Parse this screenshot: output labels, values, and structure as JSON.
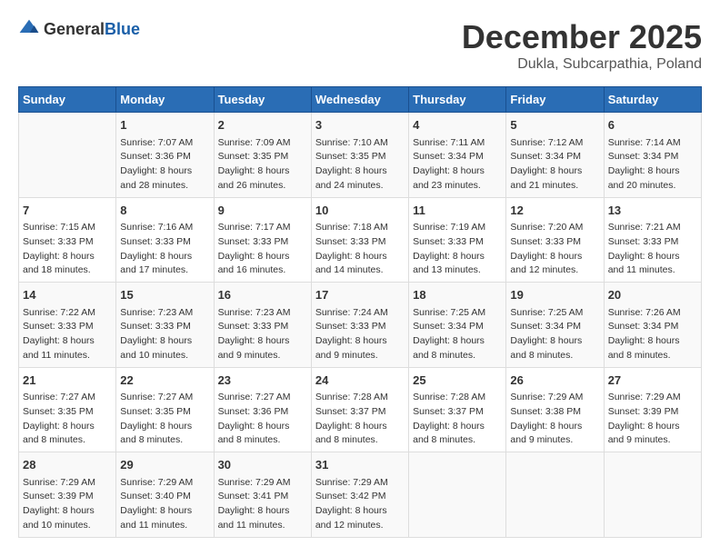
{
  "header": {
    "logo_general": "General",
    "logo_blue": "Blue",
    "title": "December 2025",
    "subtitle": "Dukla, Subcarpathia, Poland"
  },
  "days_of_week": [
    "Sunday",
    "Monday",
    "Tuesday",
    "Wednesday",
    "Thursday",
    "Friday",
    "Saturday"
  ],
  "weeks": [
    [
      {
        "day": "",
        "info": ""
      },
      {
        "day": "1",
        "info": "Sunrise: 7:07 AM\nSunset: 3:36 PM\nDaylight: 8 hours\nand 28 minutes."
      },
      {
        "day": "2",
        "info": "Sunrise: 7:09 AM\nSunset: 3:35 PM\nDaylight: 8 hours\nand 26 minutes."
      },
      {
        "day": "3",
        "info": "Sunrise: 7:10 AM\nSunset: 3:35 PM\nDaylight: 8 hours\nand 24 minutes."
      },
      {
        "day": "4",
        "info": "Sunrise: 7:11 AM\nSunset: 3:34 PM\nDaylight: 8 hours\nand 23 minutes."
      },
      {
        "day": "5",
        "info": "Sunrise: 7:12 AM\nSunset: 3:34 PM\nDaylight: 8 hours\nand 21 minutes."
      },
      {
        "day": "6",
        "info": "Sunrise: 7:14 AM\nSunset: 3:34 PM\nDaylight: 8 hours\nand 20 minutes."
      }
    ],
    [
      {
        "day": "7",
        "info": "Sunrise: 7:15 AM\nSunset: 3:33 PM\nDaylight: 8 hours\nand 18 minutes."
      },
      {
        "day": "8",
        "info": "Sunrise: 7:16 AM\nSunset: 3:33 PM\nDaylight: 8 hours\nand 17 minutes."
      },
      {
        "day": "9",
        "info": "Sunrise: 7:17 AM\nSunset: 3:33 PM\nDaylight: 8 hours\nand 16 minutes."
      },
      {
        "day": "10",
        "info": "Sunrise: 7:18 AM\nSunset: 3:33 PM\nDaylight: 8 hours\nand 14 minutes."
      },
      {
        "day": "11",
        "info": "Sunrise: 7:19 AM\nSunset: 3:33 PM\nDaylight: 8 hours\nand 13 minutes."
      },
      {
        "day": "12",
        "info": "Sunrise: 7:20 AM\nSunset: 3:33 PM\nDaylight: 8 hours\nand 12 minutes."
      },
      {
        "day": "13",
        "info": "Sunrise: 7:21 AM\nSunset: 3:33 PM\nDaylight: 8 hours\nand 11 minutes."
      }
    ],
    [
      {
        "day": "14",
        "info": "Sunrise: 7:22 AM\nSunset: 3:33 PM\nDaylight: 8 hours\nand 11 minutes."
      },
      {
        "day": "15",
        "info": "Sunrise: 7:23 AM\nSunset: 3:33 PM\nDaylight: 8 hours\nand 10 minutes."
      },
      {
        "day": "16",
        "info": "Sunrise: 7:23 AM\nSunset: 3:33 PM\nDaylight: 8 hours\nand 9 minutes."
      },
      {
        "day": "17",
        "info": "Sunrise: 7:24 AM\nSunset: 3:33 PM\nDaylight: 8 hours\nand 9 minutes."
      },
      {
        "day": "18",
        "info": "Sunrise: 7:25 AM\nSunset: 3:34 PM\nDaylight: 8 hours\nand 8 minutes."
      },
      {
        "day": "19",
        "info": "Sunrise: 7:25 AM\nSunset: 3:34 PM\nDaylight: 8 hours\nand 8 minutes."
      },
      {
        "day": "20",
        "info": "Sunrise: 7:26 AM\nSunset: 3:34 PM\nDaylight: 8 hours\nand 8 minutes."
      }
    ],
    [
      {
        "day": "21",
        "info": "Sunrise: 7:27 AM\nSunset: 3:35 PM\nDaylight: 8 hours\nand 8 minutes."
      },
      {
        "day": "22",
        "info": "Sunrise: 7:27 AM\nSunset: 3:35 PM\nDaylight: 8 hours\nand 8 minutes."
      },
      {
        "day": "23",
        "info": "Sunrise: 7:27 AM\nSunset: 3:36 PM\nDaylight: 8 hours\nand 8 minutes."
      },
      {
        "day": "24",
        "info": "Sunrise: 7:28 AM\nSunset: 3:37 PM\nDaylight: 8 hours\nand 8 minutes."
      },
      {
        "day": "25",
        "info": "Sunrise: 7:28 AM\nSunset: 3:37 PM\nDaylight: 8 hours\nand 8 minutes."
      },
      {
        "day": "26",
        "info": "Sunrise: 7:29 AM\nSunset: 3:38 PM\nDaylight: 8 hours\nand 9 minutes."
      },
      {
        "day": "27",
        "info": "Sunrise: 7:29 AM\nSunset: 3:39 PM\nDaylight: 8 hours\nand 9 minutes."
      }
    ],
    [
      {
        "day": "28",
        "info": "Sunrise: 7:29 AM\nSunset: 3:39 PM\nDaylight: 8 hours\nand 10 minutes."
      },
      {
        "day": "29",
        "info": "Sunrise: 7:29 AM\nSunset: 3:40 PM\nDaylight: 8 hours\nand 11 minutes."
      },
      {
        "day": "30",
        "info": "Sunrise: 7:29 AM\nSunset: 3:41 PM\nDaylight: 8 hours\nand 11 minutes."
      },
      {
        "day": "31",
        "info": "Sunrise: 7:29 AM\nSunset: 3:42 PM\nDaylight: 8 hours\nand 12 minutes."
      },
      {
        "day": "",
        "info": ""
      },
      {
        "day": "",
        "info": ""
      },
      {
        "day": "",
        "info": ""
      }
    ]
  ]
}
